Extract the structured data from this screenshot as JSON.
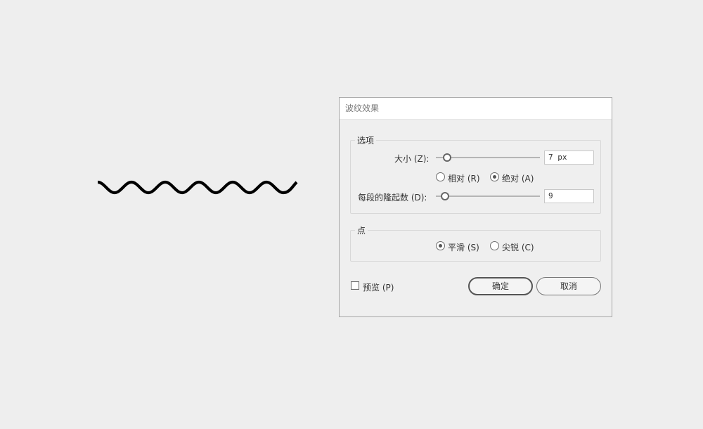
{
  "dialog": {
    "title": "波纹效果",
    "options_group": {
      "legend": "选项",
      "size": {
        "label": "大小 (Z):",
        "value": "7 px",
        "slider_fraction": 0.11
      },
      "mode": {
        "relative_label": "相对 (R)",
        "absolute_label": "绝对 (A)",
        "selected": "absolute"
      },
      "ridges": {
        "label": "每段的隆起数 (D):",
        "value": "9",
        "slider_fraction": 0.09
      }
    },
    "points_group": {
      "legend": "点",
      "smooth_label": "平滑 (S)",
      "corner_label": "尖锐 (C)",
      "selected": "smooth"
    },
    "preview_label": "预览 (P)",
    "preview_checked": false,
    "ok_label": "确定",
    "cancel_label": "取消"
  },
  "colors": {
    "canvas": "#eeeeee",
    "wave_stroke": "#000000",
    "dialog_bg": "#efefef"
  },
  "icons": {
    "wave": "zigzag-smooth-wave-path"
  }
}
